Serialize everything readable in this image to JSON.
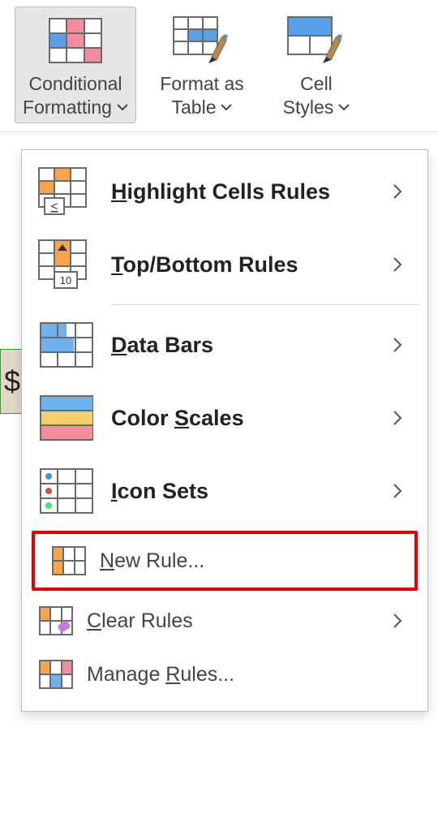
{
  "ribbon": {
    "conditional_formatting": {
      "line1": "Conditional",
      "line2": "Formatting"
    },
    "format_as_table": {
      "line1": "Format as",
      "line2": "Table"
    },
    "cell_styles": {
      "line1": "Cell",
      "line2": "Styles"
    }
  },
  "sheet": {
    "partial_value": "$"
  },
  "menu": {
    "highlight_cells_rules": "Highlight Cells Rules",
    "top_bottom_rules": "Top/Bottom Rules",
    "data_bars": "Data Bars",
    "color_scales": "Color Scales",
    "icon_sets": "Icon Sets",
    "new_rule": "New Rule...",
    "clear_rules": "Clear Rules",
    "manage_rules": "Manage Rules..."
  }
}
